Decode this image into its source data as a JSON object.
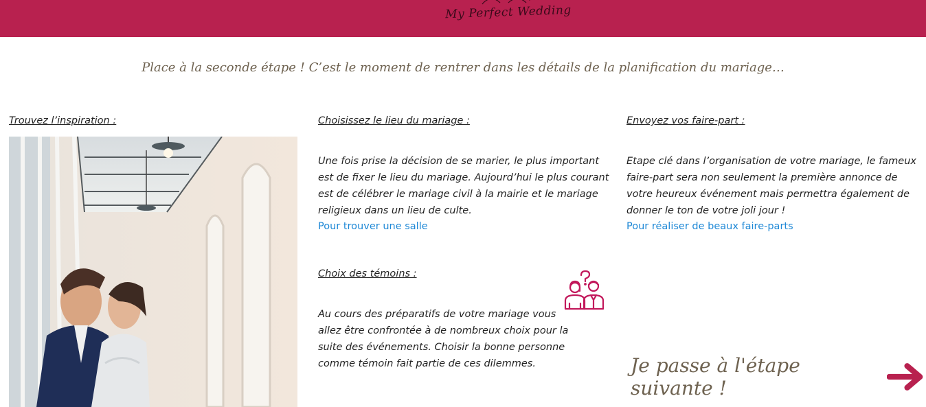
{
  "header": {
    "brand": "My Perfect Wedding",
    "background": "#b8214f"
  },
  "intro": "Place à la seconde étape ! C’est le moment de rentrer dans les détails de la planification du mariage…",
  "col1": {
    "title": "Trouvez l’inspiration :",
    "image": "wedding-couple-photo"
  },
  "col2": {
    "venue_title": "Choisissez le lieu du mariage :",
    "venue_lines": [
      "Une fois prise la décision de se marier, le plus important",
      "est de fixer le lieu du mariage. Aujourd’hui le plus courant",
      "est de célébrer le mariage civil à la mairie et le mariage",
      "religieux dans un lieu de culte."
    ],
    "venue_link": "Pour trouver une salle",
    "witness_title": "Choix des témoins :",
    "witness_icon": "couple-question-icon",
    "witness_lines": [
      "Au cours des préparatifs de votre mariage vous",
      "allez être confrontée à de nombreux choix pour la",
      "suite des événements. Choisir la bonne personne",
      "comme témoin fait partie de ces dilemmes."
    ]
  },
  "col3": {
    "title": "Envoyez vos faire-part :",
    "lines": [
      "Etape clé dans l’organisation de votre mariage, le fameux",
      "faire-part sera non seulement la première annonce de",
      "votre heureux événement mais permettra également de",
      "donner le ton de votre joli jour !"
    ],
    "link": "Pour réaliser de beaux faire-parts"
  },
  "next": {
    "label": "Je passe à l'étape suivante !",
    "icon": "arrow-right-icon",
    "accent": "#b8214f"
  },
  "colors": {
    "link": "#1e88d6",
    "heading": "#6e6250",
    "accent": "#b8214f"
  }
}
